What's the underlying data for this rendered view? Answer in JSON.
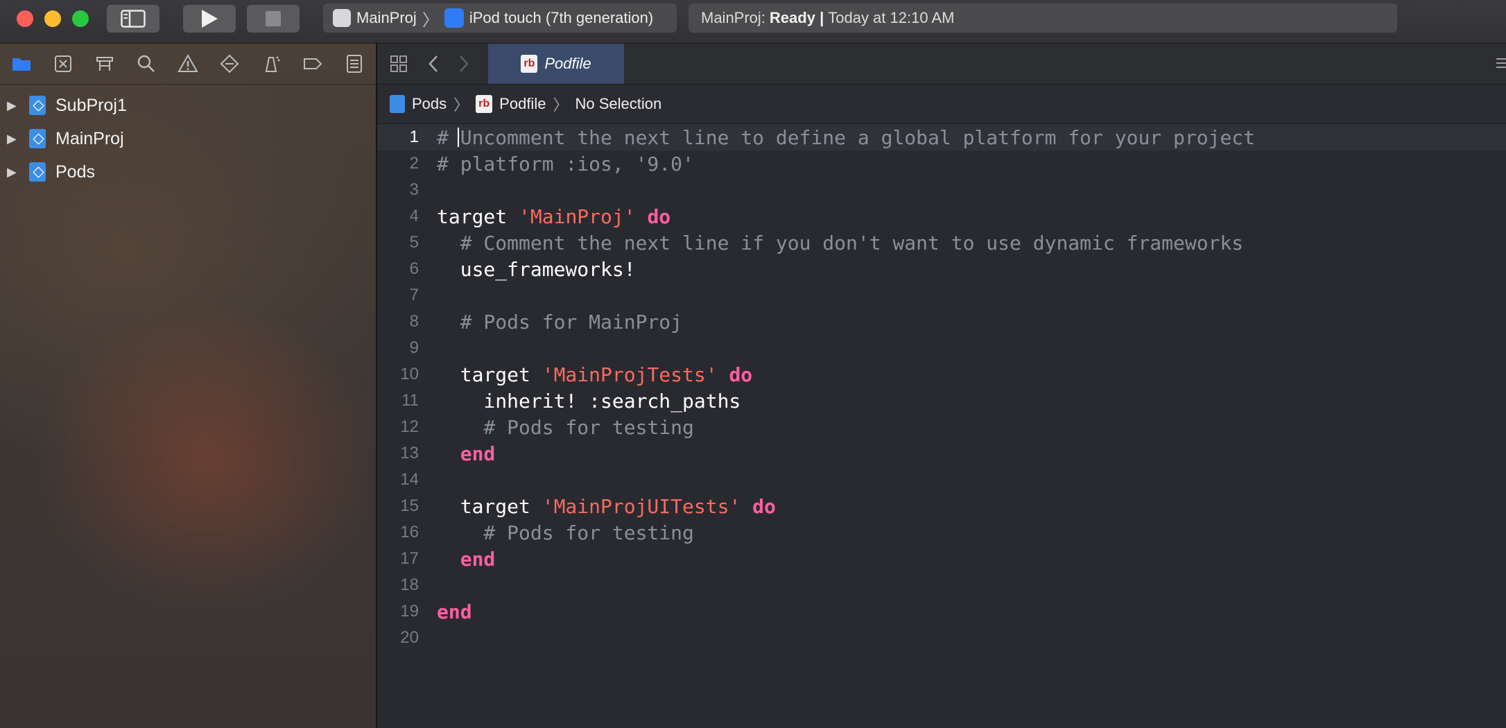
{
  "toolbar": {
    "scheme_project": "MainProj",
    "scheme_device": "iPod touch (7th generation)",
    "activity_project": "MainProj:",
    "activity_status": "Ready |",
    "activity_time": "Today at 12:10 AM"
  },
  "navigator": {
    "tabs": [
      "folder-icon",
      "source-control-icon",
      "symbol-icon",
      "find-icon",
      "issue-icon",
      "test-icon",
      "debug-icon",
      "breakpoint-icon",
      "report-icon"
    ],
    "items": [
      {
        "label": "SubProj1"
      },
      {
        "label": "MainProj"
      },
      {
        "label": "Pods"
      }
    ]
  },
  "editor": {
    "active_tab": "Podfile",
    "file_icon_text": "rb",
    "jumpbar": {
      "project": "Pods",
      "file": "Podfile",
      "selection": "No Selection"
    },
    "lines": [
      {
        "n": "1",
        "current": true,
        "tokens": [
          {
            "t": "# Uncomment the next line to define a global platform for your project",
            "c": "comment"
          }
        ]
      },
      {
        "n": "2",
        "tokens": [
          {
            "t": "# platform :ios, '9.0'",
            "c": "comment"
          }
        ]
      },
      {
        "n": "3",
        "tokens": []
      },
      {
        "n": "4",
        "tokens": [
          {
            "t": "target ",
            "c": "plain"
          },
          {
            "t": "'MainProj'",
            "c": "string"
          },
          {
            "t": " ",
            "c": "plain"
          },
          {
            "t": "do",
            "c": "kw"
          }
        ]
      },
      {
        "n": "5",
        "tokens": [
          {
            "t": "  # Comment the next line if you don't want to use dynamic frameworks",
            "c": "comment"
          }
        ]
      },
      {
        "n": "6",
        "tokens": [
          {
            "t": "  use_frameworks!",
            "c": "plain"
          }
        ]
      },
      {
        "n": "7",
        "tokens": []
      },
      {
        "n": "8",
        "tokens": [
          {
            "t": "  # Pods for MainProj",
            "c": "comment"
          }
        ]
      },
      {
        "n": "9",
        "tokens": []
      },
      {
        "n": "10",
        "tokens": [
          {
            "t": "  target ",
            "c": "plain"
          },
          {
            "t": "'MainProjTests'",
            "c": "string"
          },
          {
            "t": " ",
            "c": "plain"
          },
          {
            "t": "do",
            "c": "kw"
          }
        ]
      },
      {
        "n": "11",
        "tokens": [
          {
            "t": "    inherit! :search_paths",
            "c": "plain"
          }
        ]
      },
      {
        "n": "12",
        "tokens": [
          {
            "t": "    # Pods for testing",
            "c": "comment"
          }
        ]
      },
      {
        "n": "13",
        "tokens": [
          {
            "t": "  ",
            "c": "plain"
          },
          {
            "t": "end",
            "c": "kw"
          }
        ]
      },
      {
        "n": "14",
        "tokens": []
      },
      {
        "n": "15",
        "tokens": [
          {
            "t": "  target ",
            "c": "plain"
          },
          {
            "t": "'MainProjUITests'",
            "c": "string"
          },
          {
            "t": " ",
            "c": "plain"
          },
          {
            "t": "do",
            "c": "kw"
          }
        ]
      },
      {
        "n": "16",
        "tokens": [
          {
            "t": "    # Pods for testing",
            "c": "comment"
          }
        ]
      },
      {
        "n": "17",
        "tokens": [
          {
            "t": "  ",
            "c": "plain"
          },
          {
            "t": "end",
            "c": "kw"
          }
        ]
      },
      {
        "n": "18",
        "tokens": []
      },
      {
        "n": "19",
        "tokens": [
          {
            "t": "end",
            "c": "kw"
          }
        ]
      },
      {
        "n": "20",
        "tokens": []
      }
    ]
  },
  "colors": {
    "comment": "#8b8f98",
    "string": "#fc6a5d",
    "keyword": "#fc5fa3",
    "tab_active": "#3a4b6b"
  }
}
